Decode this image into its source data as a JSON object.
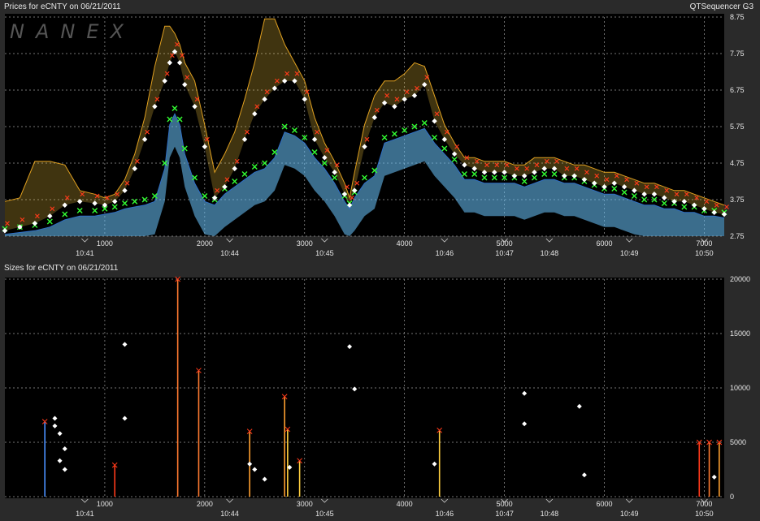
{
  "app": {
    "watermark": "NANEX",
    "brand": "QTSequencer G3"
  },
  "colors": {
    "bid": "#6cc6ff",
    "bid_dark": "#2f6fc6",
    "ask": "#e0a020",
    "ask_light": "#ffd040",
    "trade_marker": "#ffffff",
    "red_marker": "#ff3a1a",
    "green_marker": "#33ff33",
    "grid": "#9a9a9a"
  },
  "chart_data": [
    {
      "type": "line",
      "title": "Prices for  eCNTY  on  06/21/2011",
      "xlim": [
        0,
        7200
      ],
      "ylim": [
        2.75,
        8.75
      ],
      "yticks": [
        8.75,
        7.75,
        6.75,
        5.75,
        4.75,
        3.75,
        2.75
      ],
      "xticks": [
        1000,
        2000,
        3000,
        4000,
        5000,
        6000,
        7000
      ],
      "time_ticks": [
        {
          "x": 800,
          "label": "10:41"
        },
        {
          "x": 2250,
          "label": "10:44"
        },
        {
          "x": 3200,
          "label": "10:45"
        },
        {
          "x": 4400,
          "label": "10:46"
        },
        {
          "x": 5000,
          "label": "10:47"
        },
        {
          "x": 5450,
          "label": "10:48"
        },
        {
          "x": 6250,
          "label": "10:49"
        },
        {
          "x": 7000,
          "label": "10:50"
        }
      ],
      "series": [
        {
          "role": "trade",
          "x": [
            0,
            150,
            300,
            450,
            600,
            750,
            900,
            1000,
            1100,
            1200,
            1300,
            1400,
            1500,
            1600,
            1650,
            1700,
            1750,
            1800,
            1900,
            2000,
            2100,
            2200,
            2300,
            2400,
            2500,
            2600,
            2700,
            2800,
            2900,
            3000,
            3100,
            3200,
            3300,
            3400,
            3450,
            3500,
            3600,
            3700,
            3800,
            3900,
            4000,
            4100,
            4200,
            4300,
            4400,
            4500,
            4600,
            4700,
            4800,
            4900,
            5000,
            5100,
            5200,
            5300,
            5400,
            5500,
            5600,
            5700,
            5800,
            5900,
            6000,
            6100,
            6200,
            6300,
            6400,
            6500,
            6600,
            6700,
            6800,
            6900,
            7000,
            7100,
            7200
          ],
          "y": [
            2.9,
            3.0,
            3.1,
            3.3,
            3.6,
            3.7,
            3.65,
            3.6,
            3.7,
            4.0,
            4.6,
            5.4,
            6.3,
            7.0,
            7.5,
            7.8,
            7.5,
            6.9,
            6.3,
            5.2,
            3.8,
            4.1,
            4.6,
            5.4,
            6.1,
            6.5,
            6.8,
            7.0,
            7.0,
            6.5,
            5.4,
            4.9,
            4.5,
            3.9,
            3.6,
            4.0,
            5.2,
            6.0,
            6.4,
            6.3,
            6.5,
            6.6,
            6.9,
            5.9,
            5.4,
            5.0,
            4.7,
            4.6,
            4.5,
            4.5,
            4.5,
            4.4,
            4.4,
            4.5,
            4.6,
            4.6,
            4.4,
            4.4,
            4.3,
            4.2,
            4.1,
            4.2,
            4.1,
            4.0,
            3.9,
            3.9,
            3.8,
            3.7,
            3.7,
            3.6,
            3.5,
            3.4,
            3.35
          ]
        },
        {
          "role": "ask",
          "x": [
            0,
            150,
            300,
            450,
            600,
            750,
            900,
            1000,
            1100,
            1200,
            1300,
            1400,
            1500,
            1600,
            1650,
            1700,
            1750,
            1800,
            1900,
            2000,
            2100,
            2200,
            2300,
            2400,
            2500,
            2600,
            2700,
            2800,
            2900,
            3000,
            3100,
            3200,
            3300,
            3400,
            3450,
            3500,
            3600,
            3700,
            3800,
            3900,
            4000,
            4100,
            4200,
            4300,
            4400,
            4500,
            4600,
            4700,
            4800,
            4900,
            5000,
            5100,
            5200,
            5300,
            5400,
            5500,
            5600,
            5700,
            5800,
            5900,
            6000,
            6100,
            6200,
            6300,
            6400,
            6500,
            6600,
            6700,
            6800,
            6900,
            7000,
            7100,
            7200
          ],
          "y": [
            3.7,
            3.8,
            4.8,
            4.8,
            4.7,
            4.0,
            3.9,
            3.8,
            3.9,
            4.3,
            5.0,
            6.0,
            7.4,
            8.5,
            8.5,
            8.3,
            8.0,
            7.5,
            7.0,
            5.8,
            4.5,
            5.0,
            5.6,
            6.5,
            7.5,
            8.7,
            8.7,
            8.0,
            7.5,
            7.0,
            6.0,
            5.3,
            4.8,
            4.2,
            3.8,
            4.5,
            5.8,
            6.6,
            7.0,
            7.0,
            7.2,
            7.5,
            7.4,
            6.6,
            5.8,
            5.3,
            4.9,
            4.9,
            4.8,
            4.8,
            4.8,
            4.7,
            4.7,
            4.9,
            4.9,
            4.9,
            4.8,
            4.7,
            4.7,
            4.6,
            4.5,
            4.5,
            4.4,
            4.3,
            4.2,
            4.2,
            4.1,
            4.0,
            4.0,
            3.9,
            3.8,
            3.7,
            3.6
          ]
        },
        {
          "role": "bid",
          "x": [
            0,
            150,
            300,
            450,
            600,
            750,
            900,
            1000,
            1100,
            1200,
            1300,
            1400,
            1500,
            1600,
            1650,
            1700,
            1750,
            1800,
            1900,
            2000,
            2100,
            2200,
            2300,
            2400,
            2500,
            2600,
            2700,
            2800,
            2900,
            3000,
            3100,
            3200,
            3300,
            3400,
            3450,
            3500,
            3600,
            3700,
            3800,
            3900,
            4000,
            4100,
            4200,
            4300,
            4400,
            4500,
            4600,
            4700,
            4800,
            4900,
            5000,
            5100,
            5200,
            5300,
            5400,
            5500,
            5600,
            5700,
            5800,
            5900,
            6000,
            6100,
            6200,
            6300,
            6400,
            6500,
            6600,
            6700,
            6800,
            6900,
            7000,
            7100,
            7200
          ],
          "y": [
            2.8,
            2.85,
            2.9,
            3.0,
            3.2,
            3.3,
            3.3,
            3.35,
            3.4,
            3.5,
            3.55,
            3.6,
            3.7,
            4.6,
            5.8,
            6.1,
            5.8,
            5.0,
            4.2,
            3.7,
            3.6,
            3.9,
            4.1,
            4.3,
            4.5,
            4.6,
            4.9,
            5.6,
            5.5,
            5.3,
            4.9,
            4.6,
            4.2,
            3.7,
            3.5,
            3.8,
            4.2,
            4.4,
            5.3,
            5.4,
            5.5,
            5.6,
            5.7,
            5.3,
            5.0,
            4.7,
            4.3,
            4.3,
            4.2,
            4.2,
            4.2,
            4.2,
            4.1,
            4.2,
            4.3,
            4.3,
            4.2,
            4.2,
            4.1,
            4.0,
            3.9,
            3.9,
            3.8,
            3.7,
            3.6,
            3.6,
            3.5,
            3.5,
            3.4,
            3.4,
            3.3,
            3.3,
            3.25
          ]
        }
      ]
    },
    {
      "type": "scatter",
      "title": "Sizes for  eCNTY  on  06/21/2011",
      "xlim": [
        0,
        7200
      ],
      "ylim": [
        0,
        20000
      ],
      "yticks": [
        20000,
        15000,
        10000,
        5000,
        0
      ],
      "xticks": [
        1000,
        2000,
        3000,
        4000,
        5000,
        6000,
        7000
      ],
      "time_ticks": [
        {
          "x": 800,
          "label": "10:41"
        },
        {
          "x": 2250,
          "label": "10:44"
        },
        {
          "x": 3200,
          "label": "10:45"
        },
        {
          "x": 4400,
          "label": "10:46"
        },
        {
          "x": 5000,
          "label": "10:47"
        },
        {
          "x": 5450,
          "label": "10:48"
        },
        {
          "x": 6250,
          "label": "10:49"
        },
        {
          "x": 7000,
          "label": "10:50"
        }
      ],
      "trade_points": [
        {
          "x": 1200,
          "y": 14000
        },
        {
          "x": 3450,
          "y": 13800
        },
        {
          "x": 3500,
          "y": 9900
        },
        {
          "x": 1200,
          "y": 7200
        },
        {
          "x": 5200,
          "y": 9500
        },
        {
          "x": 5200,
          "y": 6700
        },
        {
          "x": 5750,
          "y": 8300
        },
        {
          "x": 500,
          "y": 7200
        },
        {
          "x": 500,
          "y": 6500
        },
        {
          "x": 550,
          "y": 5800
        },
        {
          "x": 600,
          "y": 4400
        },
        {
          "x": 550,
          "y": 3300
        },
        {
          "x": 600,
          "y": 2500
        },
        {
          "x": 2450,
          "y": 3000
        },
        {
          "x": 2500,
          "y": 2500
        },
        {
          "x": 2850,
          "y": 2700
        },
        {
          "x": 2600,
          "y": 1600
        },
        {
          "x": 4300,
          "y": 3000
        },
        {
          "x": 5800,
          "y": 2000
        },
        {
          "x": 7100,
          "y": 1800
        }
      ],
      "spikes": [
        {
          "x": 1730,
          "y": 20000,
          "color": "#ff7a30"
        },
        {
          "x": 1940,
          "y": 11600,
          "color": "#ff7a30"
        },
        {
          "x": 2800,
          "y": 9200,
          "color": "#ffa030"
        },
        {
          "x": 2830,
          "y": 6200,
          "color": "#ffd040"
        },
        {
          "x": 400,
          "y": 6900,
          "color": "#4a90ff"
        },
        {
          "x": 2450,
          "y": 6000,
          "color": "#ffa030"
        },
        {
          "x": 4350,
          "y": 6100,
          "color": "#ffd040"
        },
        {
          "x": 1100,
          "y": 2900,
          "color": "#ff3a1a"
        },
        {
          "x": 2950,
          "y": 3300,
          "color": "#ffd040"
        },
        {
          "x": 6950,
          "y": 5000,
          "color": "#ff3a1a"
        },
        {
          "x": 7050,
          "y": 5000,
          "color": "#ff7a30"
        },
        {
          "x": 7150,
          "y": 5000,
          "color": "#ffa030"
        }
      ]
    }
  ]
}
